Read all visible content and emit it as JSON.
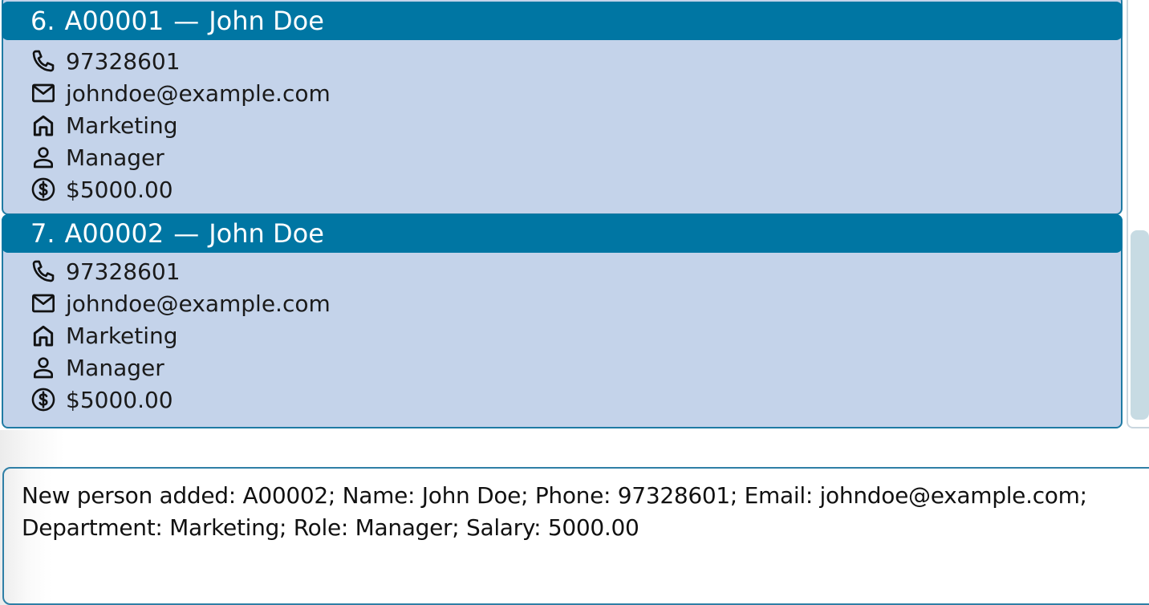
{
  "persons": [
    {
      "index": "6.",
      "id": "A00001",
      "separator": "—",
      "name": "John Doe",
      "phone": "97328601",
      "email": "johndoe@example.com",
      "department": "Marketing",
      "role": "Manager",
      "salary": "$5000.00"
    },
    {
      "index": "7.",
      "id": "A00002",
      "separator": "—",
      "name": "John Doe",
      "phone": "97328601",
      "email": "johndoe@example.com",
      "department": "Marketing",
      "role": "Manager",
      "salary": "$5000.00"
    }
  ],
  "result": {
    "line1": "New person added: A00002; Name: John Doe; Phone: 97328601; Email: johndoe@example.com;",
    "line2": "Department: Marketing; Role: Manager; Salary: 5000.00"
  },
  "icons": {
    "phone": "phone-icon",
    "email": "mail-icon",
    "department": "home-icon",
    "role": "person-icon",
    "salary": "dollar-circle-icon"
  },
  "colors": {
    "card_background": "#c4d3ea",
    "header_background": "#0076a3",
    "card_border": "#1f7ba4",
    "header_text": "#ffffff"
  }
}
